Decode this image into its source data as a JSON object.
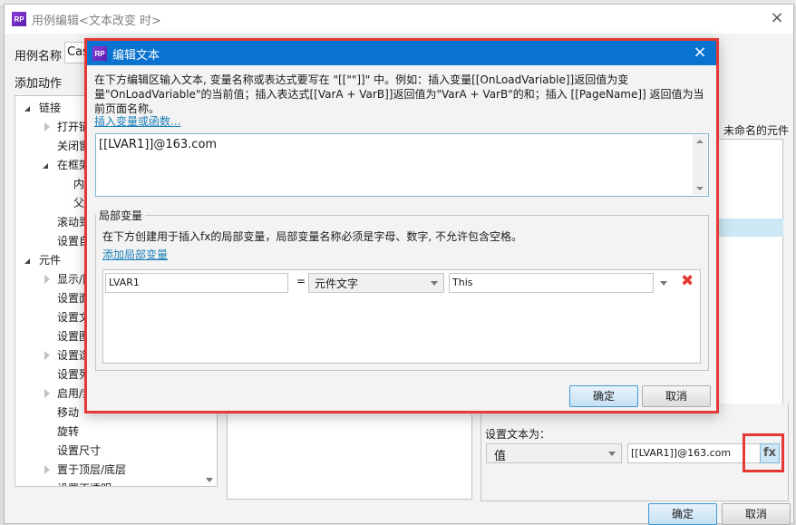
{
  "outer_dialog": {
    "logo": "RP",
    "title": "用例编辑<文本改变 时>",
    "close_icon": "×",
    "case_name_label": "用例名称",
    "case_name_value": "Cas",
    "add_action_label": "添加动作",
    "action_tree": [
      {
        "label": "链接",
        "level": 0,
        "expander": "open"
      },
      {
        "label": "打开链",
        "level": 1,
        "expander": "closed"
      },
      {
        "label": "关闭窗",
        "level": 1,
        "expander": "none"
      },
      {
        "label": "在框架",
        "level": 1,
        "expander": "open"
      },
      {
        "label": "内",
        "level": 2,
        "expander": "none"
      },
      {
        "label": "父",
        "level": 2,
        "expander": "none"
      },
      {
        "label": "滚动到",
        "level": 1,
        "expander": "none"
      },
      {
        "label": "设置自",
        "level": 1,
        "expander": "none"
      },
      {
        "label": "元件",
        "level": 0,
        "expander": "open"
      },
      {
        "label": "显示/隐",
        "level": 1,
        "expander": "closed"
      },
      {
        "label": "设置面",
        "level": 1,
        "expander": "none"
      },
      {
        "label": "设置文",
        "level": 1,
        "expander": "none"
      },
      {
        "label": "设置图",
        "level": 1,
        "expander": "none"
      },
      {
        "label": "设置选",
        "level": 1,
        "expander": "closed"
      },
      {
        "label": "设置列",
        "level": 1,
        "expander": "none"
      },
      {
        "label": "启用/禁",
        "level": 1,
        "expander": "closed"
      },
      {
        "label": "移动",
        "level": 1,
        "expander": "none"
      },
      {
        "label": "旋转",
        "level": 1,
        "expander": "none"
      },
      {
        "label": "设置尺寸",
        "level": 1,
        "expander": "none"
      },
      {
        "label": "置于顶层/底层",
        "level": 1,
        "expander": "closed"
      },
      {
        "label": "设置不透明",
        "level": 1,
        "expander": "none"
      }
    ],
    "unnamed_widgets_label": "未命名的元件",
    "set_text_label": "设置文本为：",
    "value_type_selected": "值",
    "text_value": "[[LVAR1]]@163.com",
    "fx_label": "fx",
    "ok_label": "确定",
    "cancel_label": "取消"
  },
  "edit_text_dialog": {
    "logo": "RP",
    "title": "编辑文本",
    "close_icon": "×",
    "description": "在下方编辑区输入文本, 变量名称或表达式要写在 \"[[\"\"]]\" 中。例如：插入变量[[OnLoadVariable]]返回值为变量\"OnLoadVariable\"的当前值；插入表达式[[VarA + VarB]]返回值为\"VarA + VarB\"的和；插入 [[PageName]] 返回值为当前页面名称。",
    "insert_link": "插入变量或函数...",
    "text_content": "[[LVAR1]]@163.com",
    "local_vars": {
      "legend": "局部变量",
      "description": "在下方创建用于插入fx的局部变量，局部变量名称必须是字母、数字, 不允许包含空格。",
      "add_link": "添加局部变量",
      "rows": [
        {
          "name": "LVAR1",
          "equals": "=",
          "type": "元件文字",
          "target": "This"
        }
      ]
    },
    "ok_label": "确定",
    "cancel_label": "取消"
  },
  "colors": {
    "title_bar": "#0a73cf",
    "highlight_border": "#e53935",
    "link": "#1a7fb8"
  }
}
